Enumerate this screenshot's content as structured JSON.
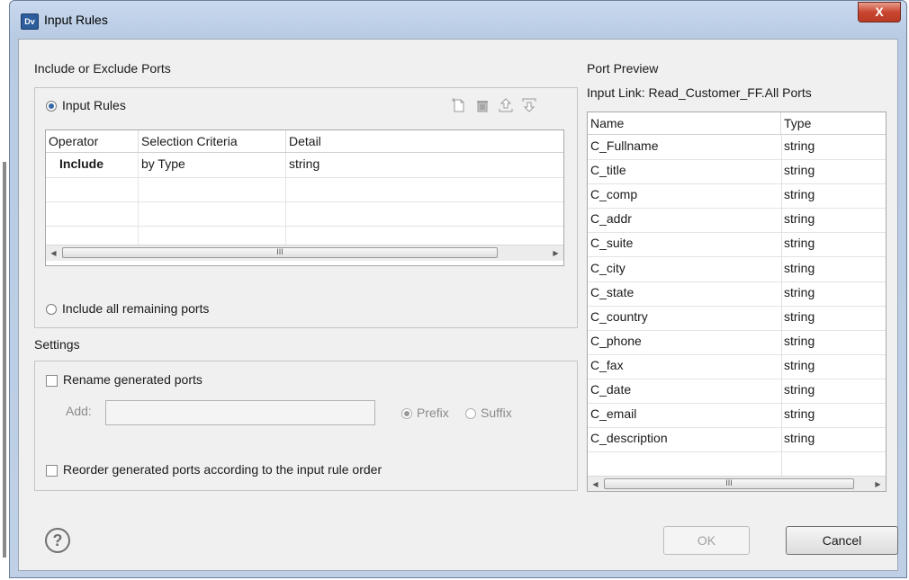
{
  "window": {
    "app_icon": "Dv",
    "title": "Input Rules",
    "close_glyph": "X"
  },
  "left_panel": {
    "section_label": "Include or Exclude Ports",
    "input_rules_radio": "Input Rules",
    "toolbar_icons": [
      "new-rule-icon",
      "delete-icon",
      "move-up-icon",
      "move-down-icon"
    ],
    "rules_table": {
      "columns": [
        "Operator",
        "Selection Criteria",
        "Detail"
      ],
      "rows": [
        [
          "Include",
          "by Type",
          "string"
        ],
        [
          "",
          "",
          ""
        ],
        [
          "",
          "",
          ""
        ],
        [
          "",
          "",
          ""
        ]
      ]
    },
    "include_all_radio": "Include all remaining ports"
  },
  "settings": {
    "section_label": "Settings",
    "rename_checkbox": "Rename generated ports",
    "add_label": "Add:",
    "add_value": "",
    "prefix_radio": "Prefix",
    "suffix_radio": "Suffix",
    "reorder_checkbox": "Reorder generated ports according to the input rule order"
  },
  "port_preview": {
    "label": "Port Preview",
    "input_link": "Input Link: Read_Customer_FF.All Ports",
    "columns": [
      "Name",
      "Type"
    ],
    "rows": [
      [
        "C_Fullname",
        "string"
      ],
      [
        "C_title",
        "string"
      ],
      [
        "C_comp",
        "string"
      ],
      [
        "C_addr",
        "string"
      ],
      [
        "C_suite",
        "string"
      ],
      [
        "C_city",
        "string"
      ],
      [
        "C_state",
        "string"
      ],
      [
        "C_country",
        "string"
      ],
      [
        "C_phone",
        "string"
      ],
      [
        "C_fax",
        "string"
      ],
      [
        "C_date",
        "string"
      ],
      [
        "C_email",
        "string"
      ],
      [
        "C_description",
        "string"
      ]
    ]
  },
  "footer": {
    "help_glyph": "?",
    "ok_label": "OK",
    "cancel_label": "Cancel"
  },
  "scrollbar_thumb_glyph": "III"
}
